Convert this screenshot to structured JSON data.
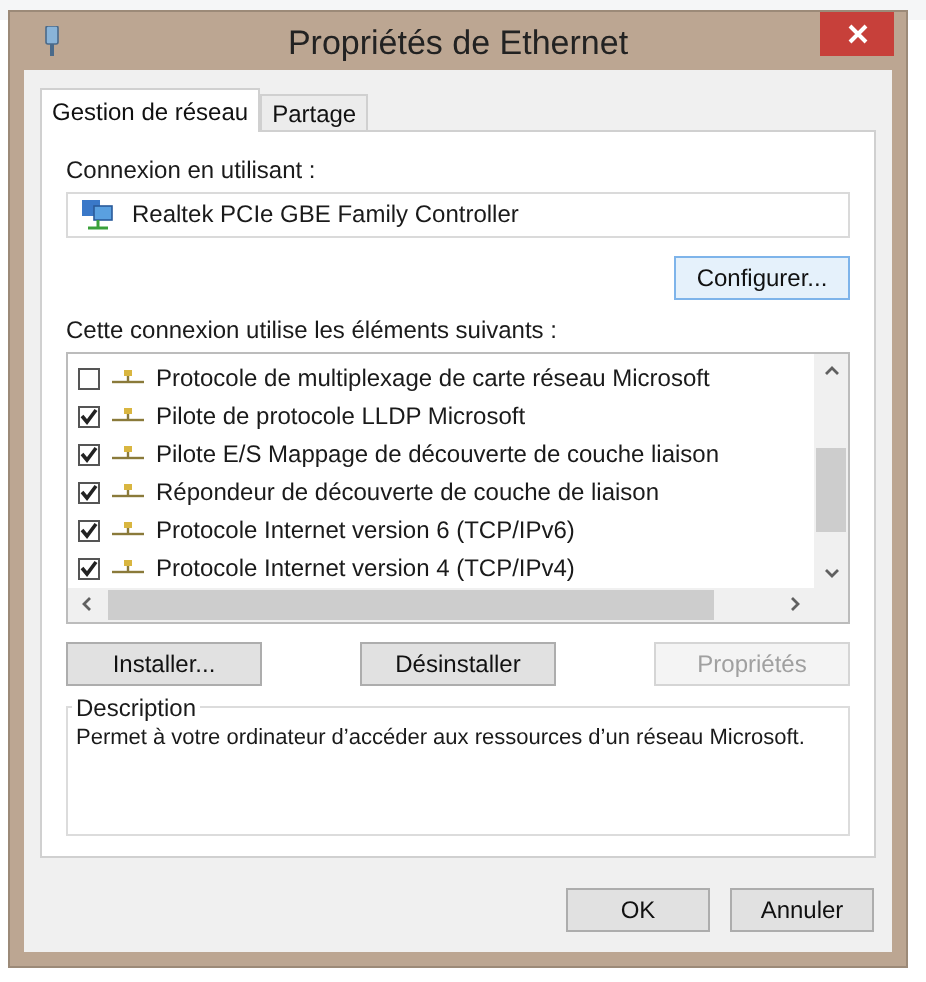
{
  "window": {
    "title": "Propriétés de Ethernet"
  },
  "tabs": [
    {
      "label": "Gestion de réseau",
      "selected": true
    },
    {
      "label": "Partage",
      "selected": false
    }
  ],
  "connection": {
    "label": "Connexion en utilisant :",
    "adapter": "Realtek PCIe GBE Family Controller",
    "configure_button": "Configurer..."
  },
  "components": {
    "label": "Cette connexion utilise les éléments suivants :",
    "items": [
      {
        "name": "Protocole de multiplexage de carte réseau Microsoft",
        "checked": false
      },
      {
        "name": "Pilote de protocole LLDP Microsoft",
        "checked": true
      },
      {
        "name": "Pilote E/S Mappage de découverte de couche liaison",
        "checked": true
      },
      {
        "name": "Répondeur de découverte de couche de liaison",
        "checked": true
      },
      {
        "name": "Protocole Internet version 6 (TCP/IPv6)",
        "checked": true
      },
      {
        "name": "Protocole Internet version 4 (TCP/IPv4)",
        "checked": true
      }
    ]
  },
  "component_buttons": [
    {
      "label": "Installer...",
      "disabled": false
    },
    {
      "label": "Désinstaller",
      "disabled": false
    },
    {
      "label": "Propriétés",
      "disabled": true
    }
  ],
  "description": {
    "title": "Description",
    "text": "Permet à votre ordinateur d’accéder aux ressources d’un réseau Microsoft."
  },
  "dialog_buttons": [
    "OK",
    "Annuler"
  ]
}
